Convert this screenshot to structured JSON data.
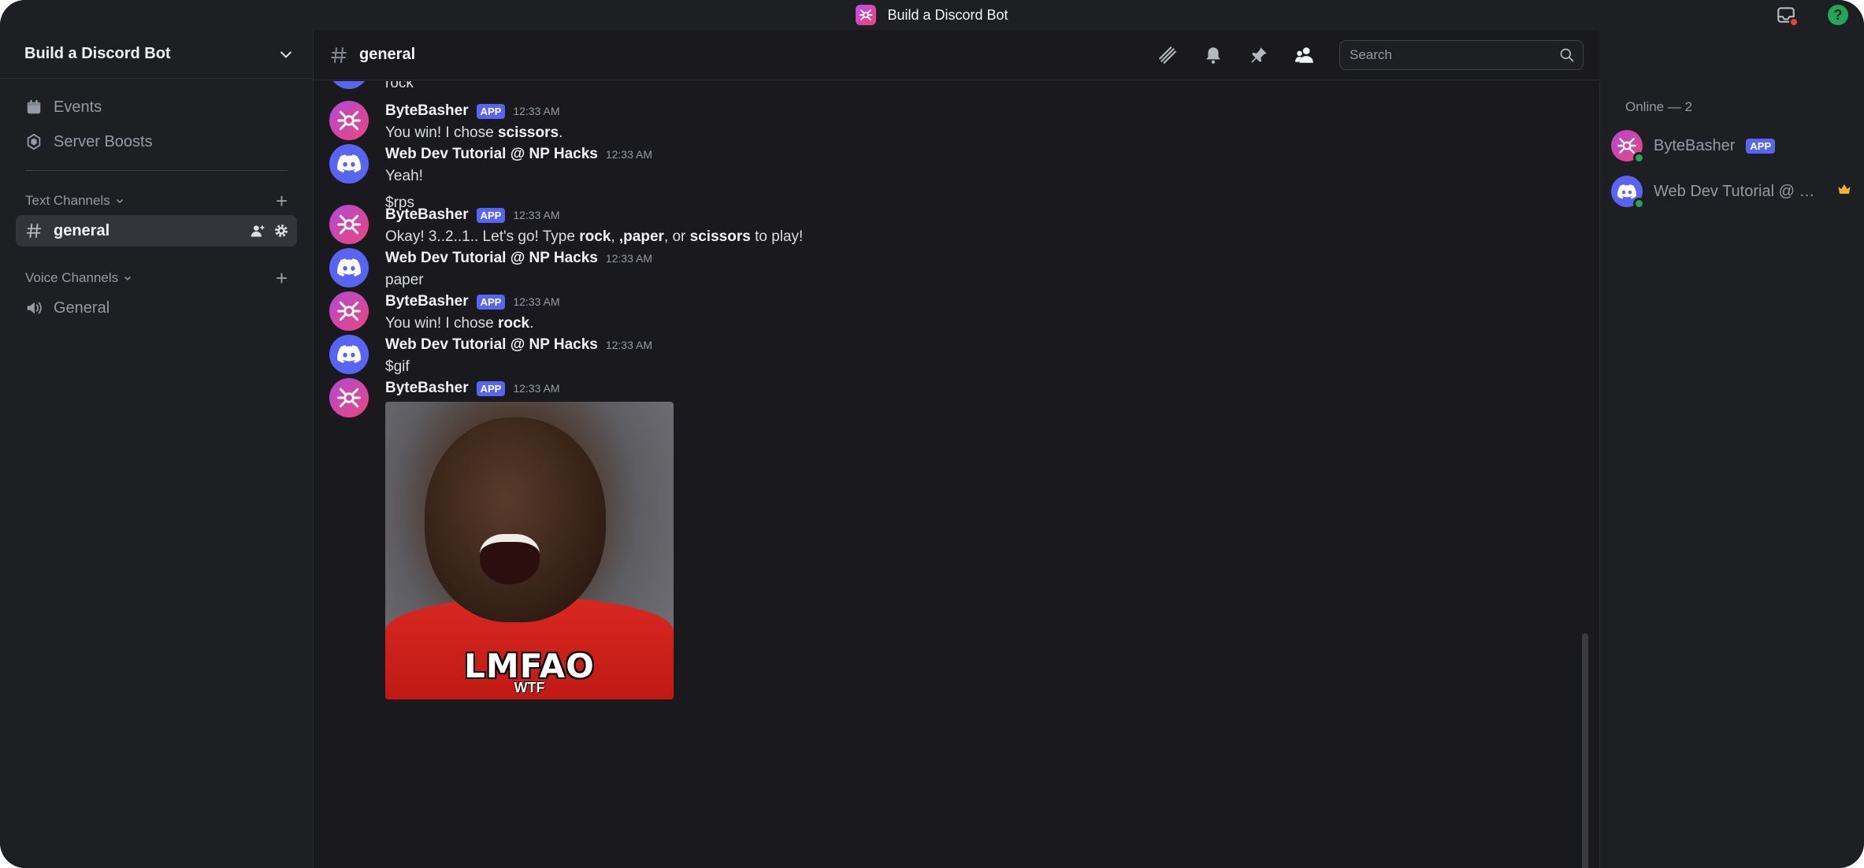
{
  "window": {
    "title": "Build a Discord Bot"
  },
  "server": {
    "name": "Build a Discord Bot",
    "nav": [
      {
        "label": "Events",
        "icon": "calendar-icon"
      },
      {
        "label": "Server Boosts",
        "icon": "boost-icon"
      }
    ],
    "categories": {
      "text": {
        "label": "Text Channels",
        "channels": [
          {
            "name": "general",
            "active": true
          }
        ]
      },
      "voice": {
        "label": "Voice Channels",
        "channels": [
          {
            "name": "General"
          }
        ]
      }
    }
  },
  "chat": {
    "channel": "general",
    "search_placeholder": "Search",
    "partial_top_text": "rock",
    "messages": [
      {
        "author": "ByteBasher",
        "badge": "APP",
        "time": "12:33 AM",
        "avatar": "bot",
        "lines": [
          {
            "pre": "You win! I chose ",
            "bold": "scissors",
            "post": "."
          }
        ]
      },
      {
        "author": "Web Dev Tutorial @ NP Hacks",
        "time": "12:33 AM",
        "avatar": "discord",
        "lines": [
          {
            "pre": "Yeah!"
          },
          {
            "pre": "$rps"
          }
        ]
      },
      {
        "author": "ByteBasher",
        "badge": "APP",
        "time": "12:33 AM",
        "avatar": "bot",
        "rich": {
          "t1": "Okay! 3..2..1.. Let's go! Type ",
          "b1": "rock",
          "t2": ", ",
          "b2": ",paper",
          "t3": ", or ",
          "b3": "scissors",
          "t4": " to play!"
        }
      },
      {
        "author": "Web Dev Tutorial @ NP Hacks",
        "time": "12:33 AM",
        "avatar": "discord",
        "lines": [
          {
            "pre": "paper"
          }
        ]
      },
      {
        "author": "ByteBasher",
        "badge": "APP",
        "time": "12:33 AM",
        "avatar": "bot",
        "lines": [
          {
            "pre": "You win! I chose ",
            "bold": "rock",
            "post": "."
          }
        ]
      },
      {
        "author": "Web Dev Tutorial @ NP Hacks",
        "time": "12:33 AM",
        "avatar": "discord",
        "lines": [
          {
            "pre": "$gif"
          }
        ]
      },
      {
        "author": "ByteBasher",
        "badge": "APP",
        "time": "12:33 AM",
        "avatar": "bot",
        "gif": {
          "caption": "LMFAO",
          "subcaption": "WTF"
        }
      }
    ]
  },
  "members": {
    "header": "Online — 2",
    "list": [
      {
        "name": "ByteBasher",
        "badge": "APP",
        "avatar": "bot"
      },
      {
        "name": "Web Dev Tutorial @ N...",
        "avatar": "discord",
        "owner": true
      }
    ]
  },
  "colors": {
    "blurple": "#5865f2",
    "online": "#23a55a",
    "background": "#1a1a1e"
  }
}
